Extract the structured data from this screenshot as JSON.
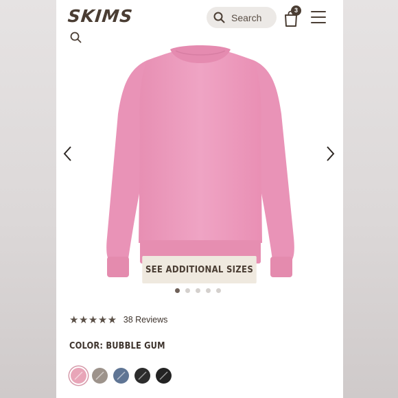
{
  "header": {
    "logo": "SKIMS",
    "search_placeholder": "Search",
    "bag_count": "3"
  },
  "gallery": {
    "image": "pink-crewneck-sweatshirt",
    "cta": "SEE ADDITIONAL SIZES",
    "slide_count": 5,
    "active_slide": 1
  },
  "rating": {
    "stars": 5,
    "reviews": "38 Reviews"
  },
  "color": {
    "label": "COLOR: BUBBLE GUM",
    "swatches": [
      {
        "color": "#e8a5b8",
        "selected": true
      },
      {
        "color": "#9d938b",
        "selected": false
      },
      {
        "color": "#5f7594",
        "selected": false
      },
      {
        "color": "#2c2c2c",
        "selected": false
      },
      {
        "color": "#232323",
        "selected": false
      }
    ]
  },
  "colors": {
    "brand": "#4a3d33",
    "product": "#ec9fbd"
  }
}
